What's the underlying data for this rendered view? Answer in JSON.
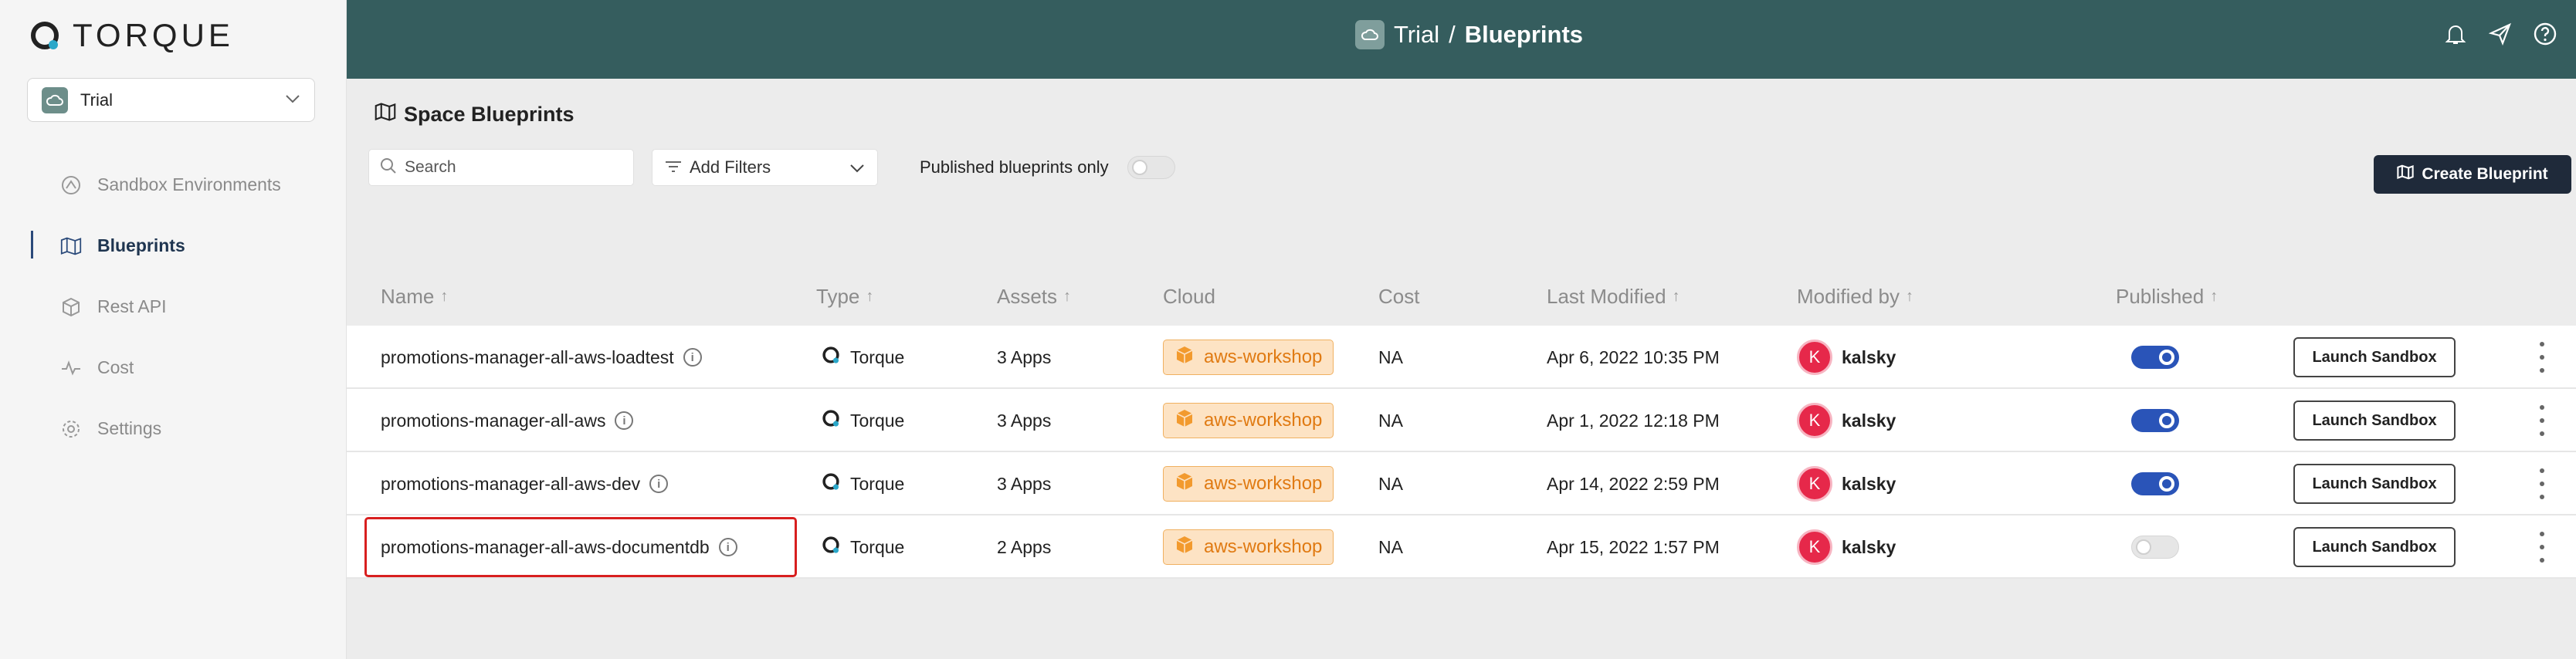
{
  "brand": {
    "name": "TORQUE"
  },
  "space": {
    "name": "Trial"
  },
  "nav": [
    {
      "label": "Sandbox Environments",
      "icon": "sandbox-icon",
      "active": false
    },
    {
      "label": "Blueprints",
      "icon": "map-icon",
      "active": true
    },
    {
      "label": "Rest API",
      "icon": "cube-icon",
      "active": false
    },
    {
      "label": "Cost",
      "icon": "pulse-icon",
      "active": false
    },
    {
      "label": "Settings",
      "icon": "gear-icon",
      "active": false
    }
  ],
  "header": {
    "space": "Trial",
    "separator": "/",
    "page": "Blueprints"
  },
  "page": {
    "title": "Space Blueprints",
    "search_placeholder": "Search",
    "filters_label": "Add Filters",
    "published_only_label": "Published blueprints only",
    "create_label": "Create Blueprint"
  },
  "table": {
    "columns": [
      "Name",
      "Type",
      "Assets",
      "Cloud",
      "Cost",
      "Last Modified",
      "Modified by",
      "Published"
    ],
    "rows": [
      {
        "name": "promotions-manager-all-aws-loadtest",
        "type": "Torque",
        "assets": "3 Apps",
        "cloud": "aws-workshop",
        "cost": "NA",
        "modified": "Apr 6, 2022 10:35 PM",
        "avatar": "K",
        "by": "kalsky",
        "published": true,
        "action": "Launch Sandbox"
      },
      {
        "name": "promotions-manager-all-aws",
        "type": "Torque",
        "assets": "3 Apps",
        "cloud": "aws-workshop",
        "cost": "NA",
        "modified": "Apr 1, 2022 12:18 PM",
        "avatar": "K",
        "by": "kalsky",
        "published": true,
        "action": "Launch Sandbox"
      },
      {
        "name": "promotions-manager-all-aws-dev",
        "type": "Torque",
        "assets": "3 Apps",
        "cloud": "aws-workshop",
        "cost": "NA",
        "modified": "Apr 14, 2022 2:59 PM",
        "avatar": "K",
        "by": "kalsky",
        "published": true,
        "action": "Launch Sandbox"
      },
      {
        "name": "promotions-manager-all-aws-documentdb",
        "type": "Torque",
        "assets": "2 Apps",
        "cloud": "aws-workshop",
        "cost": "NA",
        "modified": "Apr 15, 2022 1:57 PM",
        "avatar": "K",
        "by": "kalsky",
        "published": false,
        "action": "Launch Sandbox"
      }
    ]
  },
  "colors": {
    "header_bg": "#355d5e",
    "accent": "#2a54b8",
    "badge": "#e07a12",
    "avatar": "#e6284a",
    "highlight": "#d81f1f"
  }
}
